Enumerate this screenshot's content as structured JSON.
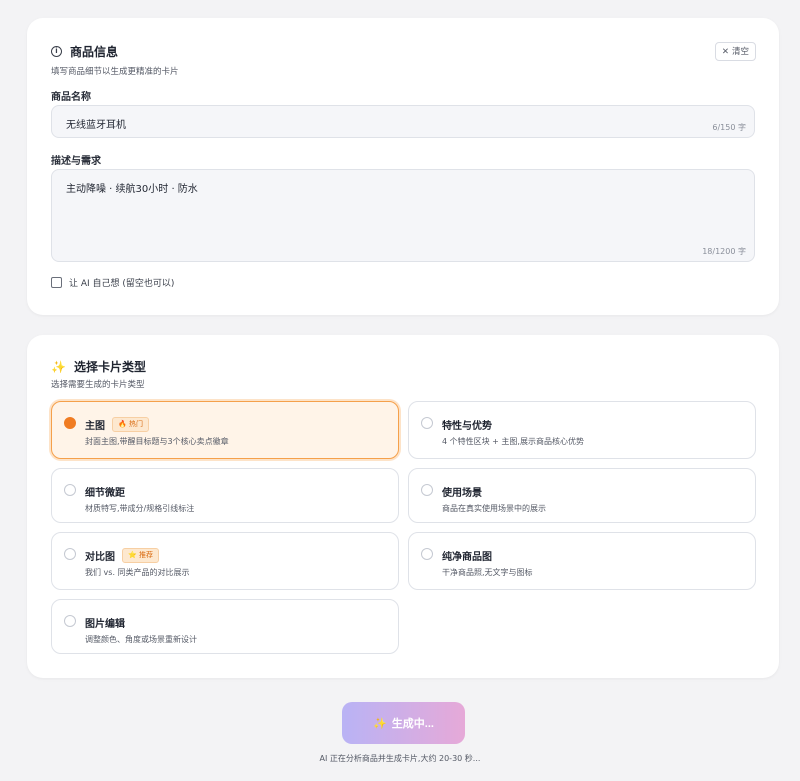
{
  "product_info": {
    "title": "商品信息",
    "subtitle": "填写商品细节以生成更精准的卡片",
    "clear_icon": "✕",
    "clear_label": "清空",
    "name_label": "商品名称",
    "name_value": "无线蓝牙耳机",
    "name_count": "6/150 字",
    "desc_label": "描述与需求",
    "desc_value": "主动降噪 · 续航30小时 · 防水",
    "desc_count": "18/1200 字",
    "ai_checkbox_label": "让 AI 自己想 (留空也可以)",
    "ai_checkbox_checked": false
  },
  "card_types": {
    "title": "选择卡片类型",
    "subtitle": "选择需要生成的卡片类型",
    "selected": "主图",
    "options": [
      {
        "title": "主图",
        "badge": "🔥 热门",
        "desc": "封面主图,带醒目标题与3个核心卖点徽章"
      },
      {
        "title": "特性与优势",
        "badge": "",
        "desc": "4 个特性区块 + 主图,展示商品核心优势"
      },
      {
        "title": "细节微距",
        "badge": "",
        "desc": "材质特写,带成分/规格引线标注"
      },
      {
        "title": "使用场景",
        "badge": "",
        "desc": "商品在真实使用场景中的展示"
      },
      {
        "title": "对比图",
        "badge": "⭐ 推荐",
        "desc": "我们 vs. 同类产品的对比展示"
      },
      {
        "title": "纯净商品图",
        "badge": "",
        "desc": "干净商品照,无文字与图标"
      },
      {
        "title": "图片编辑",
        "badge": "",
        "desc": "调整颜色、角度或场景重新设计"
      }
    ]
  },
  "generate": {
    "button_icon": "✨",
    "button_label": "生成中...",
    "status_note": "AI 正在分析商品并生成卡片,大约 20-30 秒..."
  },
  "colors": {
    "accent": "#f07c22",
    "selected_bg": "#fff4e8",
    "gradient_start": "#b9b3f5",
    "gradient_end": "#e6a9d8"
  }
}
